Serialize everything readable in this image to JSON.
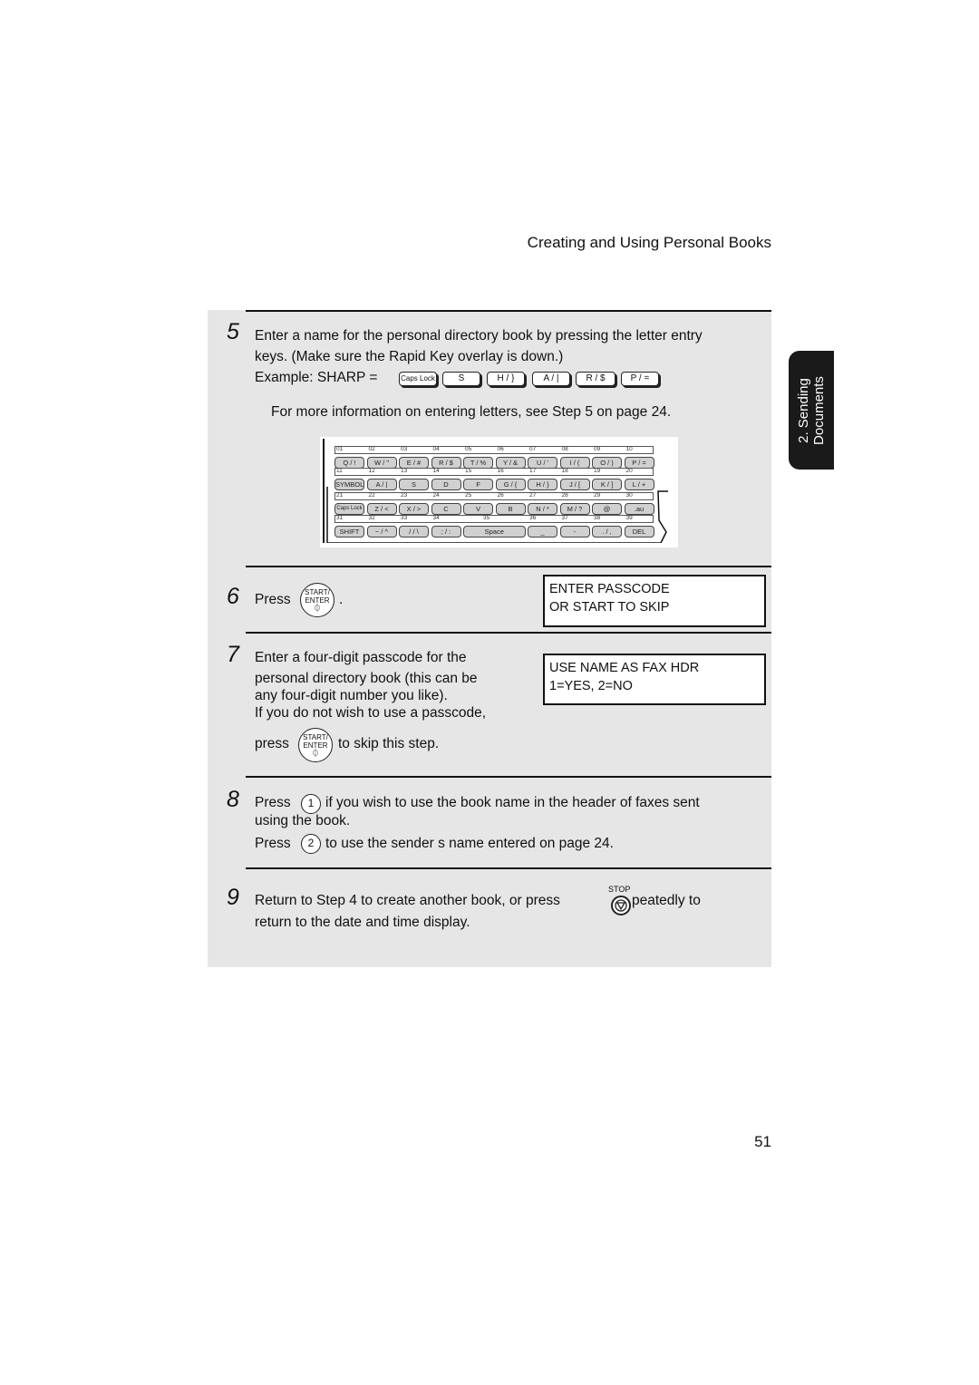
{
  "header": {
    "title": "Creating and Using Personal Books"
  },
  "side_tab": {
    "line1": "2. Sending",
    "line2": "Documents"
  },
  "page_number": "51",
  "step5": {
    "number": "5",
    "line1": "Enter a name for the personal directory book by pressing the letter entry",
    "line2": "keys. (Make sure the Rapid Key overlay is down.)",
    "example_label": "Example: SHARP =",
    "example_keys": [
      "Caps Lock",
      "S",
      "H / }",
      "A / |",
      "R / $",
      "P / ="
    ],
    "note": "For more information on entering letters, see Step 5 on page 24."
  },
  "keyboard": {
    "rows": [
      {
        "numbers": [
          "01",
          "02",
          "03",
          "04",
          "05",
          "06",
          "07",
          "08",
          "09",
          "10"
        ],
        "keys": [
          "Q / !",
          "W / \"",
          "E / #",
          "R / $",
          "T / %",
          "Y / &",
          "U / '",
          "I / (",
          "O / )",
          "P / ="
        ]
      },
      {
        "numbers": [
          "11",
          "12",
          "13",
          "14",
          "15",
          "16",
          "17",
          "18",
          "19",
          "20"
        ],
        "keys": [
          "SYMBOL",
          "A / |",
          "S",
          "D",
          "F",
          "G / {",
          "H / }",
          "J / [",
          "K / ]",
          "L / +"
        ]
      },
      {
        "numbers": [
          "21",
          "22",
          "23",
          "24",
          "25",
          "26",
          "27",
          "28",
          "29",
          "30"
        ],
        "keys": [
          "Caps Lock",
          "Z / <",
          "X / >",
          "C",
          "V",
          "B",
          "N / *",
          "M / ?",
          "@",
          ".au"
        ]
      },
      {
        "numbers": [
          "31",
          "32",
          "33",
          "34",
          "35",
          "36",
          "37",
          "38",
          "39"
        ],
        "keys": [
          "SHIFT",
          "~ / ^",
          "/ / \\",
          "; / :",
          "Space",
          "_",
          "-",
          ". / ,",
          "DEL"
        ]
      }
    ]
  },
  "step6": {
    "number": "6",
    "press_label": "Press",
    "button_top": "START/",
    "button_bottom": "ENTER",
    "after": ".",
    "display_line1": "ENTER PASSCODE",
    "display_line2": "OR START TO SKIP"
  },
  "step7": {
    "number": "7",
    "line1": "Enter a four-digit passcode for the",
    "line2": "personal directory book (this can be",
    "line3": "any four-digit number you like).",
    "line4": "If you do not wish to use a passcode,",
    "press_label": "press",
    "button_top": "START/",
    "button_bottom": "ENTER",
    "after": "to skip this step.",
    "display_line1": "USE NAME AS FAX HDR",
    "display_line2": "1=YES, 2=NO"
  },
  "step8": {
    "number": "8",
    "press1": "Press",
    "key1": "1",
    "line1_after": "if you wish to use the book name in the header of faxes sent",
    "line2": "using the book.",
    "press2": "Press",
    "key2": "2",
    "line3_after": "to use the sender   s name entered on page 24."
  },
  "step9": {
    "number": "9",
    "line1": "Return to Step 4 to create another book, or press",
    "stop_label": "STOP",
    "after": "peatedly to",
    "line2": "return to the date and time display."
  }
}
